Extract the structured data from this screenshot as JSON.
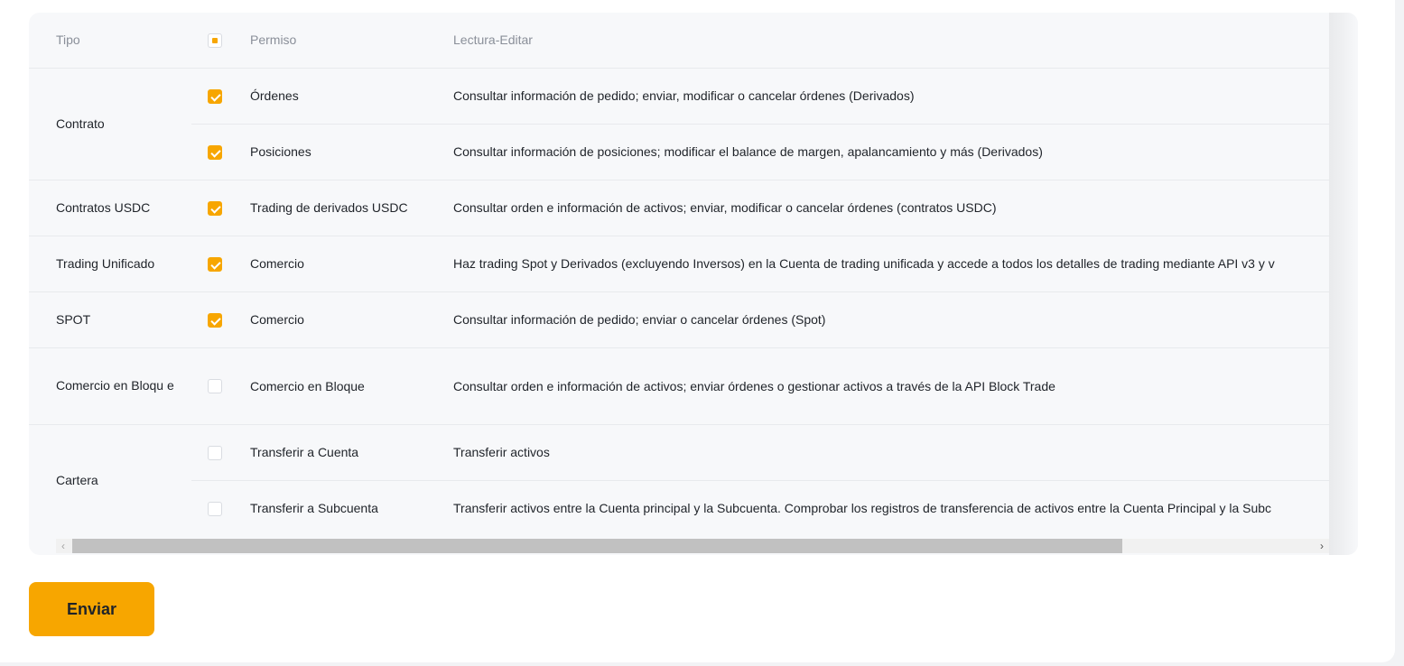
{
  "table": {
    "headers": {
      "type": "Tipo",
      "permission": "Permiso",
      "read_edit": "Lectura-Editar"
    },
    "header_checkbox_state": "partial",
    "groups": [
      {
        "type": "Contrato",
        "rows": [
          {
            "checked": true,
            "permission": "Órdenes",
            "description": "Consultar información de pedido; enviar, modificar o cancelar órdenes (Derivados)"
          },
          {
            "checked": true,
            "permission": "Posiciones",
            "description": "Consultar información de posiciones; modificar el balance de margen, apalancamiento y más (Derivados)"
          }
        ]
      },
      {
        "type": "Contratos USDC",
        "rows": [
          {
            "checked": true,
            "permission": "Trading de derivados USDC",
            "description": "Consultar orden e información de activos; enviar, modificar o cancelar órdenes (contratos USDC)"
          }
        ]
      },
      {
        "type": "Trading Unificado",
        "rows": [
          {
            "checked": true,
            "permission": "Comercio",
            "description": "Haz trading Spot y Derivados (excluyendo Inversos) en la Cuenta de trading unificada y accede a todos los detalles de trading mediante API v3 y v"
          }
        ]
      },
      {
        "type": "SPOT",
        "rows": [
          {
            "checked": true,
            "permission": "Comercio",
            "description": "Consultar información de pedido; enviar o cancelar órdenes (Spot)"
          }
        ]
      },
      {
        "type": "Comercio en Bloqu e",
        "rows": [
          {
            "checked": false,
            "permission": "Comercio en Bloque",
            "description": "Consultar orden e información de activos; enviar órdenes o gestionar activos a través de la API Block Trade"
          }
        ]
      },
      {
        "type": "Cartera",
        "rows": [
          {
            "checked": false,
            "permission": "Transferir a Cuenta",
            "description": "Transferir activos"
          },
          {
            "checked": false,
            "permission": "Transferir a Subcuenta",
            "description": "Transferir activos entre la Cuenta principal y la Subcuenta. Comprobar los registros de transferencia de activos entre la Cuenta Principal y la Subc"
          }
        ]
      }
    ]
  },
  "scrollbar": {
    "left_arrow": "‹",
    "right_arrow": "›",
    "position_fraction": 0.0
  },
  "submit": {
    "label": "Enviar"
  },
  "colors": {
    "accent": "#f7a600",
    "table_bg": "#f7f8fa"
  }
}
